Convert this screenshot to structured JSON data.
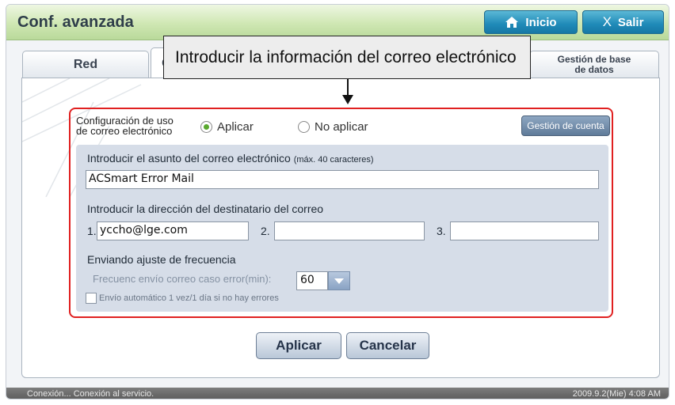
{
  "window": {
    "title": "Conf. avanzada",
    "home_label": "Inicio",
    "exit_label": "Salir"
  },
  "tabs": {
    "red": "Red",
    "mail_fragment": "C",
    "db_line1": "Gestión de base",
    "db_line2": "de datos"
  },
  "callout": "Introducir la información del correo electrónico",
  "email_config": {
    "label_line1": "Configuración de uso",
    "label_line2": "de correo electrónico",
    "radio_apply": "Aplicar",
    "radio_noapply": "No aplicar",
    "selected": "Aplicar",
    "account_button": "Gestión de cuenta"
  },
  "subject": {
    "label": "Introducir el asunto del correo electrónico",
    "hint": "(máx. 40 caracteres)",
    "value": "ACSmart Error Mail"
  },
  "recipients": {
    "label": "Introducir la dirección del destinatario del correo",
    "n1": "1.",
    "n2": "2.",
    "n3": "3.",
    "addr1": "yccho@lge.com",
    "addr2": "",
    "addr3": ""
  },
  "frequency": {
    "section_label": "Enviando ajuste de frecuencia",
    "error_label": "Frecuenc envío correo caso error(min):",
    "error_value": "60",
    "auto_label": "Envío automático 1 vez/1 día si no hay errores",
    "auto_checked": false
  },
  "buttons": {
    "apply": "Aplicar",
    "cancel": "Cancelar"
  },
  "status": {
    "left": "Conexión... Conexión al servicio.",
    "right": "2009.9.2(Mie)  4:08 AM"
  },
  "colors": {
    "title_bar": "#cfe7b3",
    "top_button": "#1f8ab8",
    "highlight_box": "#e02020",
    "panel": "#d6dde8"
  }
}
